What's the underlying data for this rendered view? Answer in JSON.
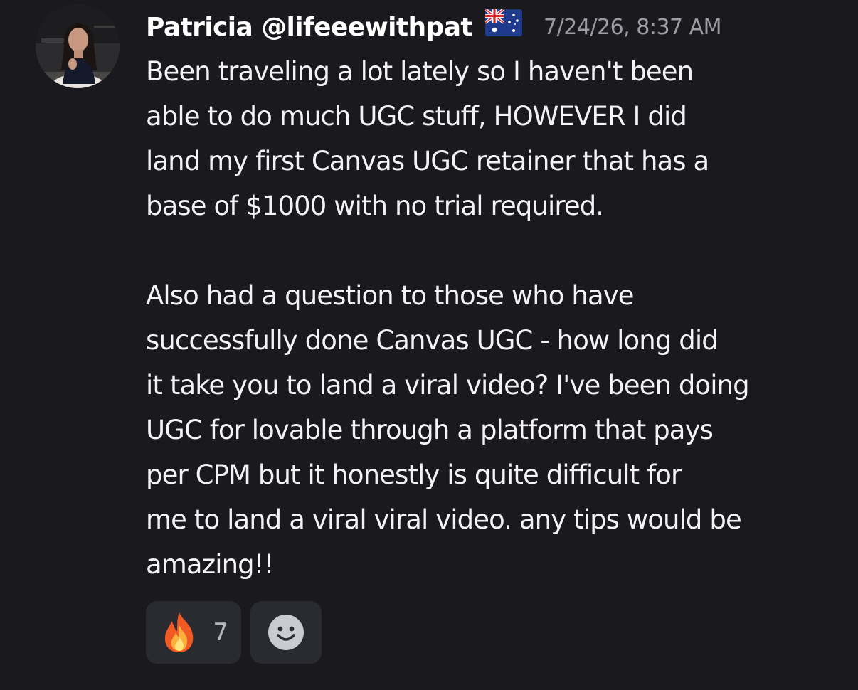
{
  "message": {
    "author": "Patricia @lifeeewithpat",
    "flag_icon": "australia-flag-icon",
    "timestamp": "7/24/26, 8:37 AM",
    "paragraphs": [
      "Been traveling a lot lately so I haven't been\nable to do much UGC stuff, HOWEVER I did\nland my first Canvas UGC retainer that has a\nbase of $1000 with no trial required.",
      "Also had a question to those who have\nsuccessfully done Canvas UGC - how long did\nit take you to land a viral video? I've been doing\nUGC for lovable through a platform that pays\nper CPM but it honestly is quite difficult for\nme to land a viral viral video. any tips would be\namazing!!"
    ]
  },
  "reactions": {
    "fire": {
      "icon": "fire-emoji-icon",
      "count": "7"
    },
    "add_reaction": {
      "icon": "smiley-face-icon"
    }
  },
  "colors": {
    "background": "#1a1a1e",
    "text": "#f2f3f5",
    "timestamp": "#9b9ca3",
    "reaction_background": "#2a2b30"
  }
}
